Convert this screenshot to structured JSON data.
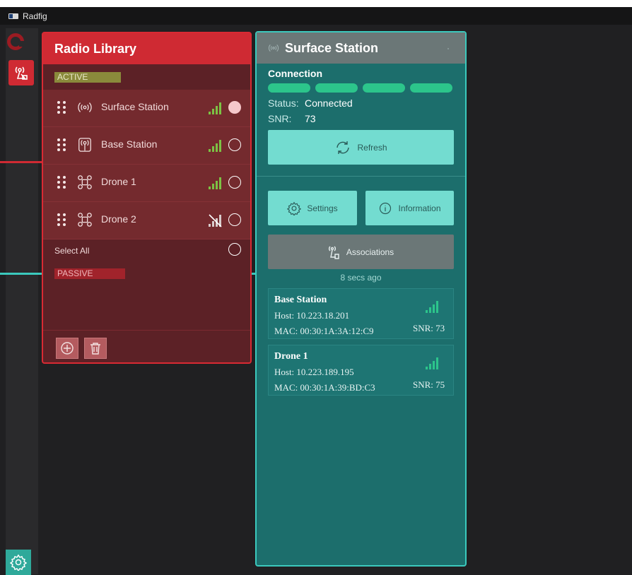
{
  "app": {
    "title": "Radfig"
  },
  "library": {
    "title": "Radio Library",
    "active_label": "ACTIVE",
    "passive_label": "PASSIVE",
    "select_all": "Select All",
    "radios": [
      {
        "name": "Surface Station",
        "icon": "antenna-icon",
        "signal": "strong",
        "selected": true
      },
      {
        "name": "Base Station",
        "icon": "antenna-icon",
        "signal": "strong",
        "selected": false
      },
      {
        "name": "Drone 1",
        "icon": "drone-icon",
        "signal": "strong",
        "selected": false
      },
      {
        "name": "Drone 2",
        "icon": "drone-icon",
        "signal": "none",
        "selected": false
      }
    ]
  },
  "station": {
    "title": "Surface Station",
    "connection_label": "Connection",
    "status_key": "Status:",
    "status_value": "Connected",
    "snr_key": "SNR:",
    "snr_value": "73",
    "refresh_label": "Refresh",
    "settings_label": "Settings",
    "information_label": "Information",
    "associations_label": "Associations",
    "updated": "8 secs ago",
    "associations": [
      {
        "name": "Base Station",
        "host": "Host: 10.223.18.201",
        "mac": "MAC: 00:30:1A:3A:12:C9",
        "snr": "SNR: 73"
      },
      {
        "name": "Drone 1",
        "host": "Host: 10.223.189.195",
        "mac": "MAC: 00:30:1A:39:BD:C3",
        "snr": "SNR: 75"
      }
    ]
  },
  "colors": {
    "accent_red": "#cf2a33",
    "accent_teal": "#3bc9bd",
    "signal_green": "#2cc58b"
  }
}
